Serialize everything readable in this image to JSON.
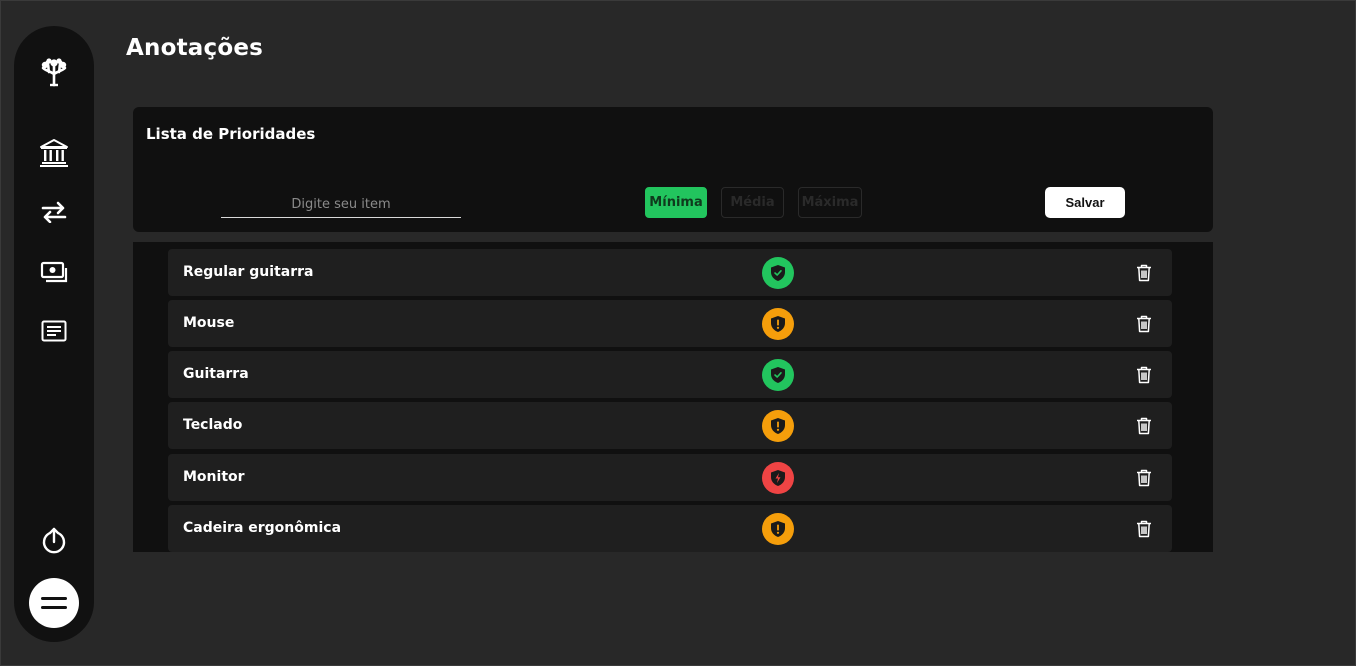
{
  "colors": {
    "page_bg": "#282828",
    "sidebar_bg": "#111111",
    "card_bg": "#101010",
    "row_bg": "#1f1f1f",
    "priority_low": "#22c55e",
    "priority_medium": "#f59e0b",
    "priority_high": "#ef4444"
  },
  "sidebar": {
    "logo_icon": "tree-logo-icon",
    "items": [
      {
        "icon": "bank-icon"
      },
      {
        "icon": "transfer-arrows-icon"
      },
      {
        "icon": "money-icon"
      },
      {
        "icon": "notes-icon"
      }
    ],
    "logout_icon": "power-icon",
    "menu_icon": "hamburger-menu-icon"
  },
  "page": {
    "title": "Anotações"
  },
  "form": {
    "card_title": "Lista de Prioridades",
    "input_placeholder": "Digite seu item",
    "priority_options": [
      "Mínima",
      "Média",
      "Máxima"
    ],
    "selected_priority": "Mínima",
    "save_label": "Salvar"
  },
  "items": [
    {
      "label": "Regular guitarra",
      "priority": "low",
      "icon": "shield-check-icon"
    },
    {
      "label": "Mouse",
      "priority": "medium",
      "icon": "shield-exclamation-icon"
    },
    {
      "label": "Guitarra",
      "priority": "low",
      "icon": "shield-check-icon"
    },
    {
      "label": "Teclado",
      "priority": "medium",
      "icon": "shield-exclamation-icon"
    },
    {
      "label": "Monitor",
      "priority": "high",
      "icon": "shield-bolt-icon"
    },
    {
      "label": "Cadeira ergonômica",
      "priority": "medium",
      "icon": "shield-exclamation-icon"
    }
  ]
}
